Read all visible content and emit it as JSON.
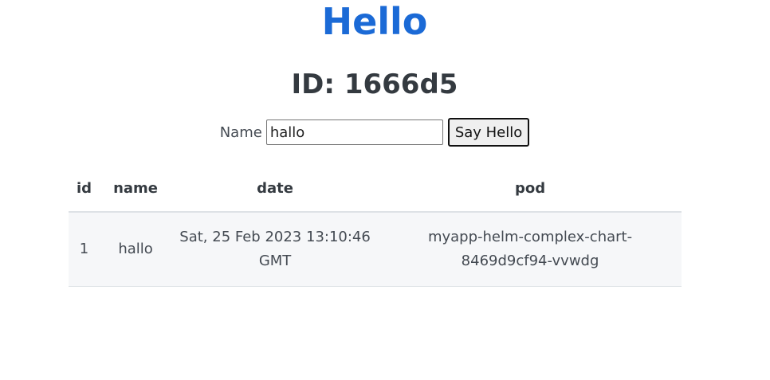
{
  "title": "Hello",
  "id_heading": "ID: 1666d5",
  "form": {
    "name_label": "Name",
    "name_value": "hallo",
    "submit_label": "Say Hello"
  },
  "table": {
    "headers": [
      "id",
      "name",
      "date",
      "pod"
    ],
    "rows": [
      [
        "1",
        "hallo",
        "Sat, 25 Feb 2023 13:10:46 GMT",
        "myapp-helm-complex-chart-8469d9cf94-vvwdg"
      ]
    ]
  },
  "colors": {
    "title": "#1b6ad6",
    "row_background": "#f6f7f9"
  }
}
